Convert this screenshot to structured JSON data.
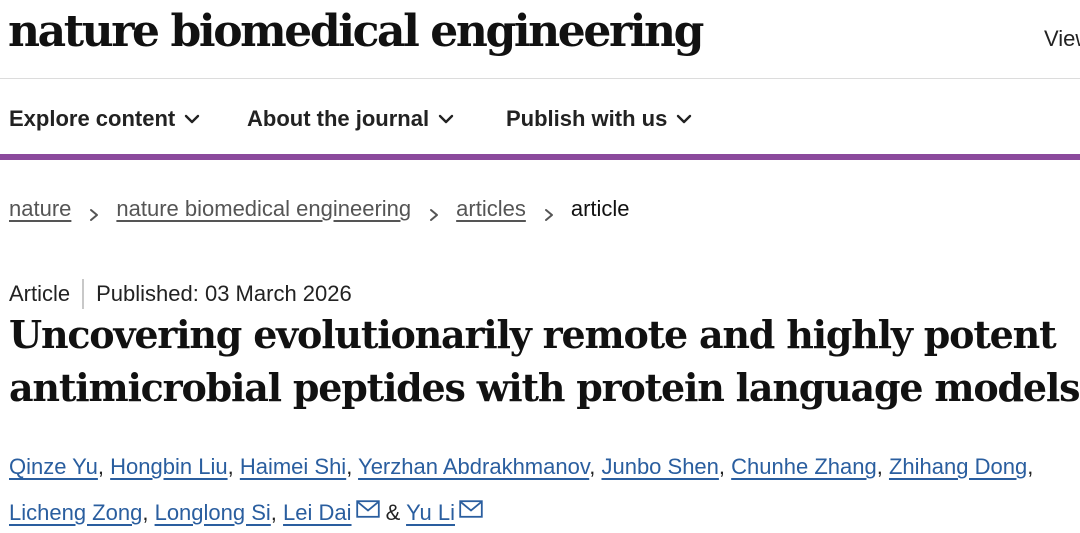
{
  "masthead": {
    "journal_name": "nature biomedical engineering",
    "view_link": "View"
  },
  "nav": {
    "items": [
      {
        "label": "Explore content"
      },
      {
        "label": "About the journal"
      },
      {
        "label": "Publish with us"
      }
    ]
  },
  "breadcrumb": {
    "items": [
      "nature",
      "nature biomedical engineering",
      "articles"
    ],
    "current": "article"
  },
  "article": {
    "type": "Article",
    "published": "Published: 03 March 2026",
    "title": "Uncovering evolutionarily remote and highly potent antimicrobial peptides with protein language models",
    "authors": [
      "Qinze Yu",
      "Hongbin Liu",
      "Haimei Shi",
      "Yerzhan Abdrakhmanov",
      "Junbo Shen",
      "Chunhe Zhang",
      "Zhihang Dong",
      "Licheng Zong",
      "Longlong Si",
      "Lei Dai",
      "Yu Li"
    ],
    "separators": {
      "comma": ",",
      "ampersand": "&"
    }
  },
  "icons": {
    "chevron": "chevron-down-icon",
    "breadcrumb_separator": "chevron-right-icon",
    "mail": "mail-icon"
  },
  "colors": {
    "accent_bar": "#8b4a9c",
    "author_link": "#2a5e9f",
    "text": "#222222"
  }
}
